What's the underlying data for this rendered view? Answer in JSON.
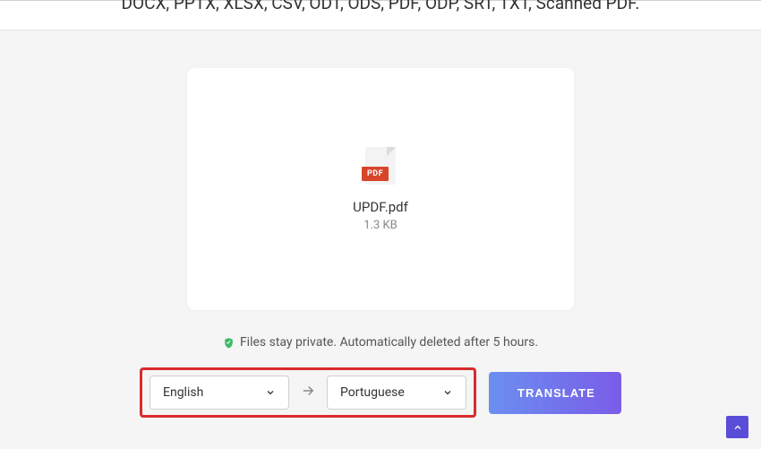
{
  "header": {
    "subtitle": "DOCX, PPTX, XLSX, CSV, ODT, ODS, PDF, ODP, SRT, TXT, Scanned PDF."
  },
  "file": {
    "badge": "PDF",
    "name": "UPDF.pdf",
    "size": "1.3 KB"
  },
  "privacy": {
    "text": "Files stay private. Automatically deleted after 5 hours."
  },
  "languages": {
    "from": "English",
    "to": "Portuguese"
  },
  "actions": {
    "translate": "TRANSLATE"
  }
}
